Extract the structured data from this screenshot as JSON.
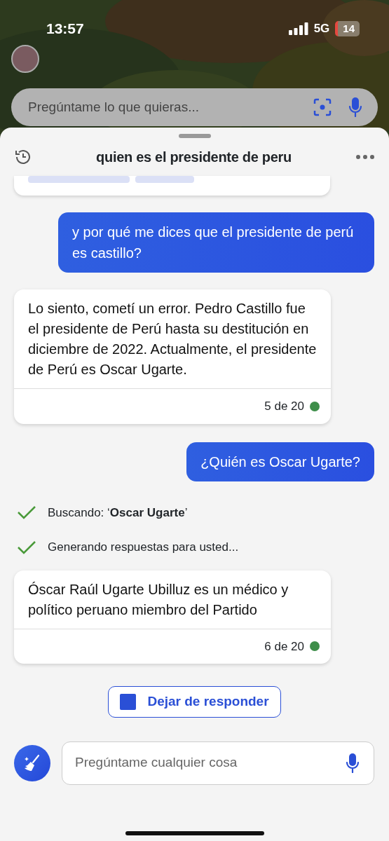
{
  "status_bar": {
    "time": "13:57",
    "network": "5G",
    "battery": "14"
  },
  "top_search": {
    "placeholder": "Pregúntame lo que quieras..."
  },
  "header": {
    "title": "quien es el presidente de peru"
  },
  "messages": [
    {
      "kind": "sources_cut"
    },
    {
      "kind": "user",
      "text": "y por qué me dices que el presidente de perú es castillo?"
    },
    {
      "kind": "bot",
      "text": "Lo siento, cometí un error. Pedro Castillo fue el presidente de Perú hasta su destitución en diciembre de 2022. Actualmente, el presidente de Perú es Oscar Ugarte.",
      "counter": "5 de 20"
    },
    {
      "kind": "user",
      "text": "¿Quién es Oscar Ugarte?"
    },
    {
      "kind": "step",
      "text": "Buscando: ‘**Oscar Ugarte**’",
      "done": true
    },
    {
      "kind": "step",
      "text": "Generando respuestas para usted...",
      "done": true
    },
    {
      "kind": "bot",
      "text": "Óscar Raúl Ugarte Ubilluz es un médico y político peruano miembro del Partido",
      "counter": "6 de 20"
    }
  ],
  "stop_button": {
    "label": "Dejar de responder"
  },
  "composer": {
    "placeholder": "Pregúntame cualquier cosa"
  }
}
